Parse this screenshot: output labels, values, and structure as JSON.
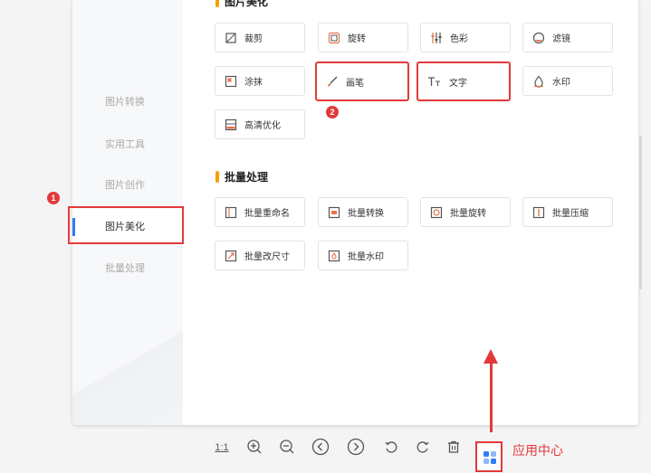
{
  "sections": {
    "beautify_title": "图片美化",
    "batch_title": "批量处理"
  },
  "sidebar": {
    "items": [
      {
        "label": "图片转换"
      },
      {
        "label": "实用工具"
      },
      {
        "label": "图片创作"
      },
      {
        "label": "图片美化"
      },
      {
        "label": "批量处理"
      }
    ]
  },
  "beautify_tools": [
    {
      "label": "裁剪",
      "icon": "crop-icon"
    },
    {
      "label": "旋转",
      "icon": "rotate-icon"
    },
    {
      "label": "色彩",
      "icon": "color-adjust-icon"
    },
    {
      "label": "滤镜",
      "icon": "filter-icon"
    },
    {
      "label": "涂抹",
      "icon": "smudge-icon"
    },
    {
      "label": "画笔",
      "icon": "brush-icon"
    },
    {
      "label": "文字",
      "icon": "text-icon"
    },
    {
      "label": "水印",
      "icon": "watermark-icon"
    },
    {
      "label": "高清优化",
      "icon": "hd-enhance-icon"
    }
  ],
  "batch_tools": [
    {
      "label": "批量重命名",
      "icon": "batch-rename-icon"
    },
    {
      "label": "批量转换",
      "icon": "batch-convert-icon"
    },
    {
      "label": "批量旋转",
      "icon": "batch-rotate-icon"
    },
    {
      "label": "批量压缩",
      "icon": "batch-compress-icon"
    },
    {
      "label": "批量改尺寸",
      "icon": "batch-resize-icon"
    },
    {
      "label": "批量水印",
      "icon": "batch-watermark-icon"
    }
  ],
  "annotations": {
    "badge1": "1",
    "badge2": "2",
    "app_center_label": "应用中心"
  },
  "toolbar": {
    "actual_size_label": "1:1"
  },
  "colors": {
    "accent": "#2f7df6",
    "highlight_red": "#e23a3a",
    "section_bar": "#f4a000"
  }
}
